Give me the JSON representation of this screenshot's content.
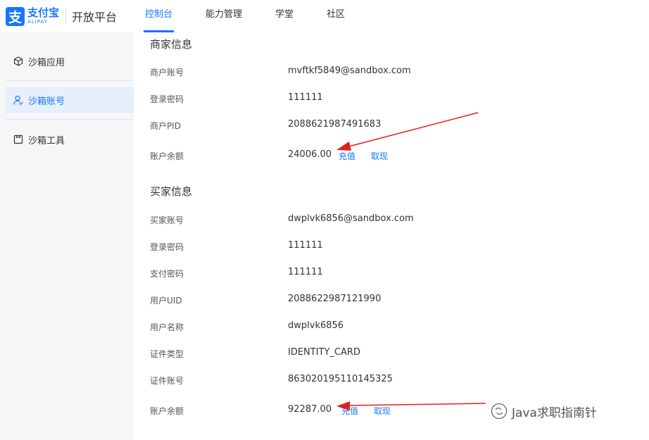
{
  "header": {
    "logo_cn": "支付宝",
    "logo_en": "ALIPAY",
    "platform": "开放平台",
    "nav": [
      {
        "label": "控制台"
      },
      {
        "label": "能力管理"
      },
      {
        "label": "学堂"
      },
      {
        "label": "社区"
      }
    ]
  },
  "sidebar": {
    "items": [
      {
        "label": "沙箱应用"
      },
      {
        "label": "沙箱账号"
      },
      {
        "label": "沙箱工具"
      }
    ]
  },
  "merchant": {
    "title": "商家信息",
    "account_label": "商户账号",
    "account": "mvftkf5849@sandbox.com",
    "password_label": "登录密码",
    "password": "111111",
    "pid_label": "商户PID",
    "pid": "2088621987491683",
    "balance_label": "账户余额",
    "balance": "24006.00",
    "recharge": "充值",
    "withdraw": "取现"
  },
  "buyer": {
    "title": "买家信息",
    "account_label": "买家账号",
    "account": "dwplvk6856@sandbox.com",
    "login_password_label": "登录密码",
    "login_password": "111111",
    "pay_password_label": "支付密码",
    "pay_password": "111111",
    "uid_label": "用户UID",
    "uid": "2088622987121990",
    "name_label": "用户名称",
    "name": "dwplvk6856",
    "id_type_label": "证件类型",
    "id_type": "IDENTITY_CARD",
    "id_number_label": "证件账号",
    "id_number": "863020195110145325",
    "balance_label": "账户余额",
    "balance": "92287.00",
    "recharge": "充值",
    "withdraw": "取现"
  },
  "watermark": "Java求职指南针",
  "colors": {
    "accent": "#1677ff",
    "annotation": "#e02020",
    "sidebar_bg": "#f5f6f8"
  }
}
